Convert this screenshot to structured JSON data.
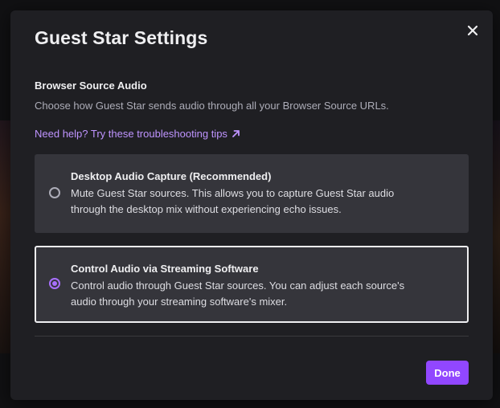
{
  "dialog": {
    "title": "Guest Star Settings",
    "close_icon": "close-icon"
  },
  "section": {
    "heading": "Browser Source Audio",
    "description": "Choose how Guest Star sends audio through all your Browser Source URLs.",
    "help_link": "Need help? Try these troubleshooting tips",
    "help_link_icon": "arrow-up-right-icon"
  },
  "options": [
    {
      "title": "Desktop Audio Capture (Recommended)",
      "description_line1": "Mute Guest Star sources. This allows you to capture Guest Star audio",
      "description_line2": "through the desktop mix without experiencing echo issues.",
      "selected": false
    },
    {
      "title": "Control Audio via Streaming Software",
      "description_line1": "Control audio through Guest Star sources. You can adjust each source's",
      "description_line2": "audio through your streaming software's mixer.",
      "selected": true
    }
  ],
  "footer": {
    "done_label": "Done"
  },
  "colors": {
    "accent": "#9147ff",
    "link": "#bf94ff",
    "dialog_bg": "#1f1f23",
    "option_bg": "#35353b"
  }
}
